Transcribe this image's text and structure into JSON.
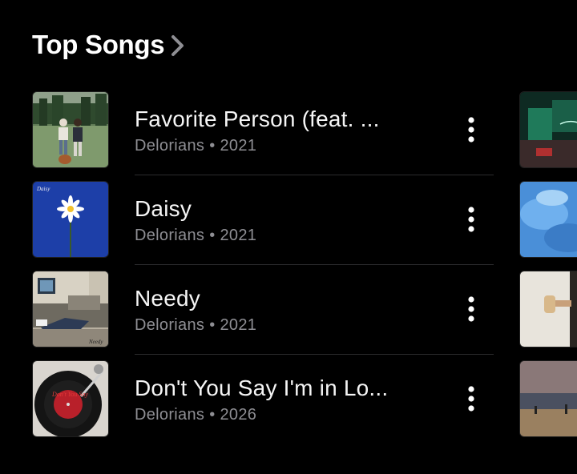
{
  "section": {
    "title": "Top Songs"
  },
  "songs": [
    {
      "title": "Favorite Person (feat. ...",
      "artist": "Delorians",
      "separator": "•",
      "year": "2021"
    },
    {
      "title": "Daisy",
      "artist": "Delorians",
      "separator": "•",
      "year": "2021"
    },
    {
      "title": "Needy",
      "artist": "Delorians",
      "separator": "•",
      "year": "2021"
    },
    {
      "title": "Don't You Say I'm in Lo...",
      "artist": "Delorians",
      "separator": "•",
      "year": "2026"
    }
  ],
  "artwork_labels": {
    "daisy": "Daisy",
    "needy": "Needy",
    "dont_you_say": "Don't You Say"
  },
  "icons": {
    "chevron": "chevron-right-icon",
    "more": "more-vertical-icon"
  },
  "colors": {
    "background": "#000000",
    "primary_text": "#f5f5f5",
    "secondary_text": "#8e8e93",
    "divider": "#2c2c2e"
  }
}
